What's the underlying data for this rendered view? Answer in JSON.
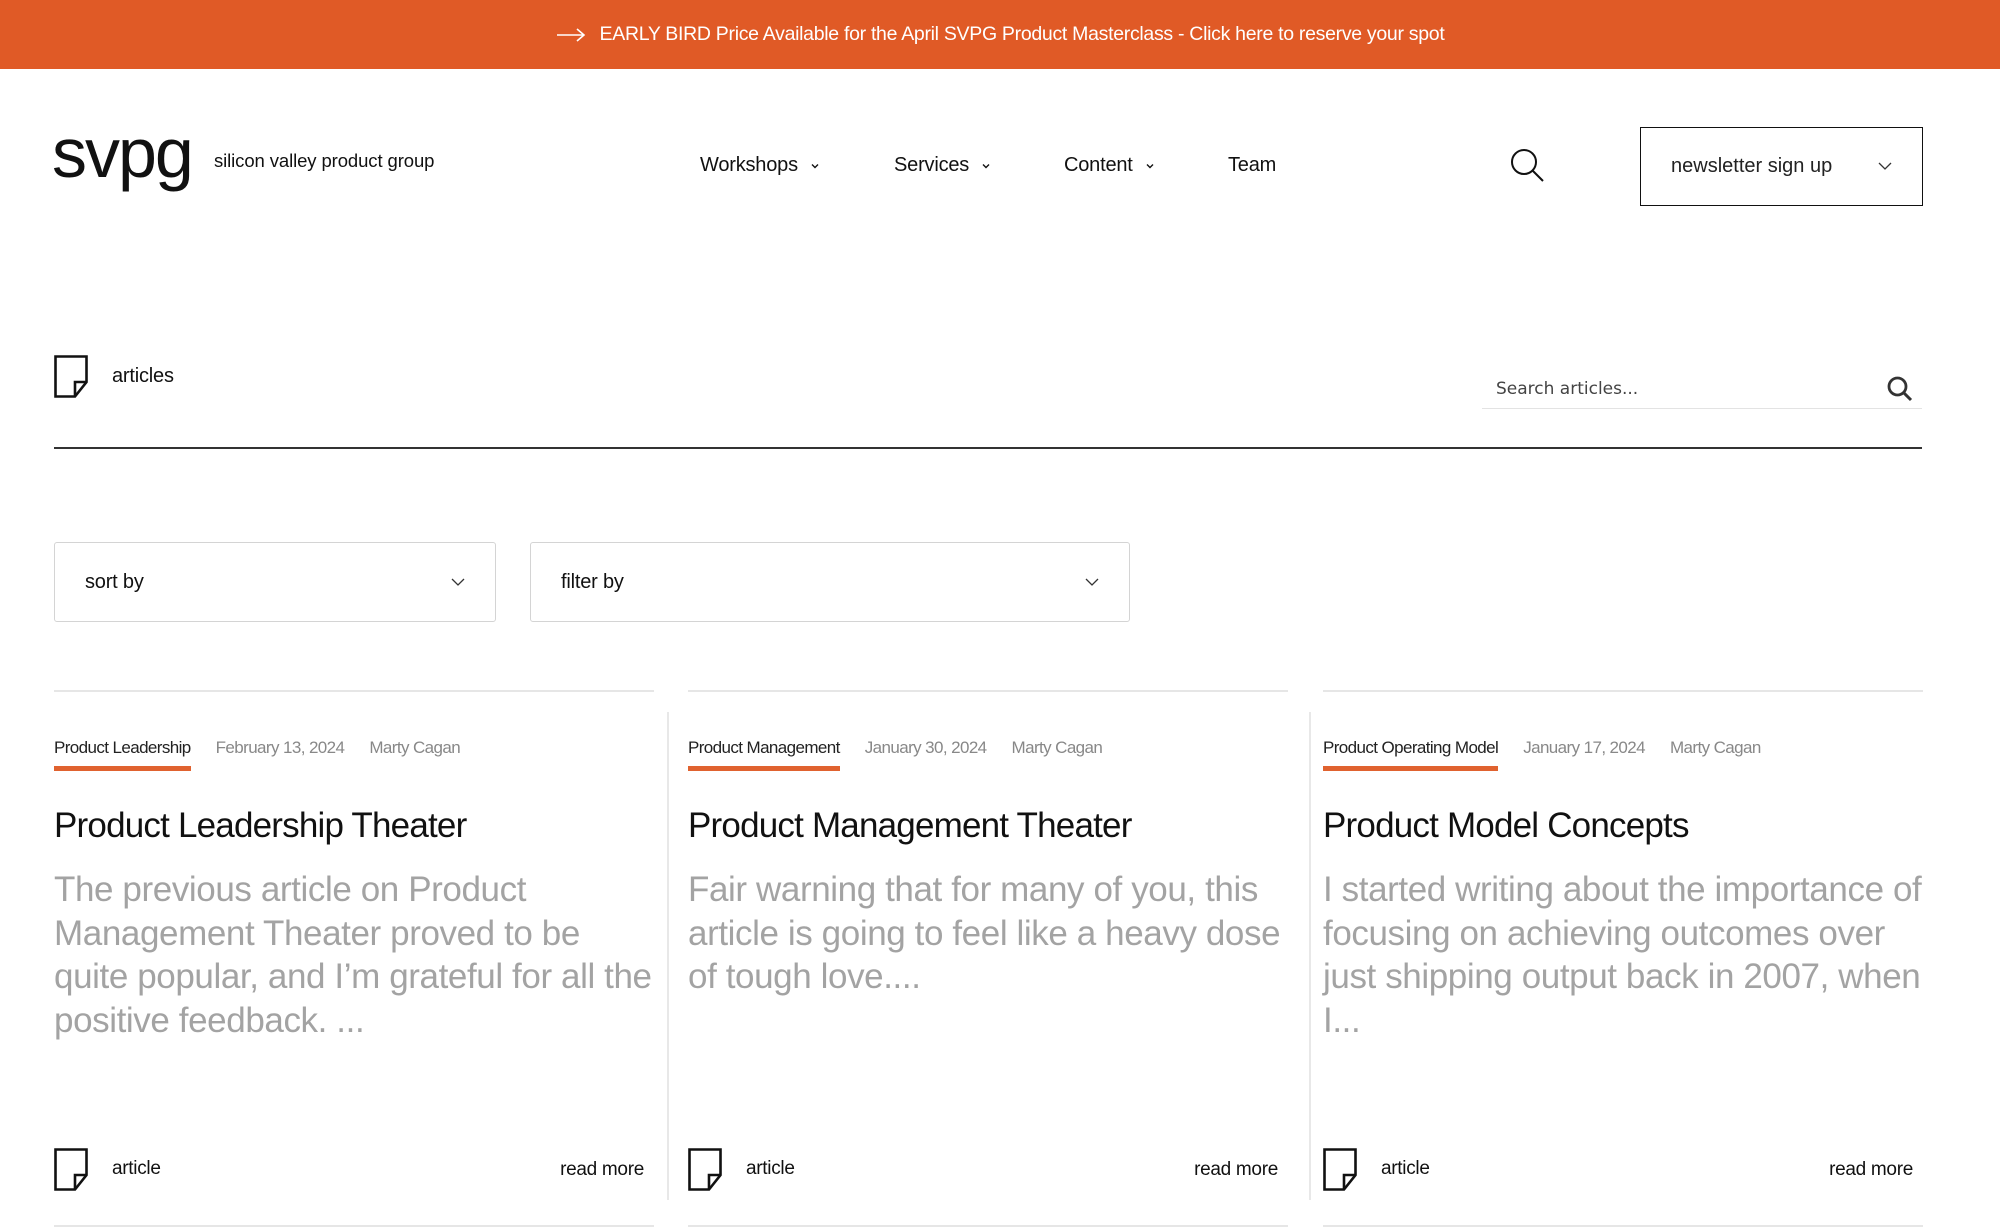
{
  "banner": {
    "icon": "arrow-right-icon",
    "text": "EARLY BIRD Price Available for the April SVPG Product Masterclass - Click here to reserve your spot",
    "color": "#E05A26"
  },
  "header": {
    "logo": "svpg",
    "tagline": "silicon valley product group",
    "nav": [
      {
        "label": "Workshops",
        "has_dropdown": true
      },
      {
        "label": "Services",
        "has_dropdown": true
      },
      {
        "label": "Content",
        "has_dropdown": true
      },
      {
        "label": "Team",
        "has_dropdown": false
      }
    ],
    "search_icon": "search-icon",
    "newsletter_label": "newsletter sign up"
  },
  "section": {
    "icon": "document-icon",
    "label": "articles",
    "search_placeholder": "Search articles..."
  },
  "controls": {
    "sort_label": "sort by",
    "filter_label": "filter by"
  },
  "accent_color": "#E0622F",
  "articles": [
    {
      "tag": "Product Leadership",
      "date": "February 13, 2024",
      "author": "Marty Cagan",
      "title": "Product Leadership Theater",
      "excerpt": "The previous article on Product Management Theater proved to be quite popular, and I’m grateful for all the positive feedback.  ...",
      "type": "article",
      "read_more": "read more"
    },
    {
      "tag": "Product Management",
      "date": "January 30, 2024",
      "author": "Marty Cagan",
      "title": "Product Management Theater",
      "excerpt": "Fair warning that for many of you, this article is going to feel like a heavy dose of tough love....",
      "type": "article",
      "read_more": "read more"
    },
    {
      "tag": "Product Operating Model",
      "date": "January 17, 2024",
      "author": "Marty Cagan",
      "title": "Product Model Concepts",
      "excerpt": "I started writing about the importance of focusing on achieving outcomes over just shipping output back in 2007, when I...",
      "type": "article",
      "read_more": "read more"
    }
  ]
}
